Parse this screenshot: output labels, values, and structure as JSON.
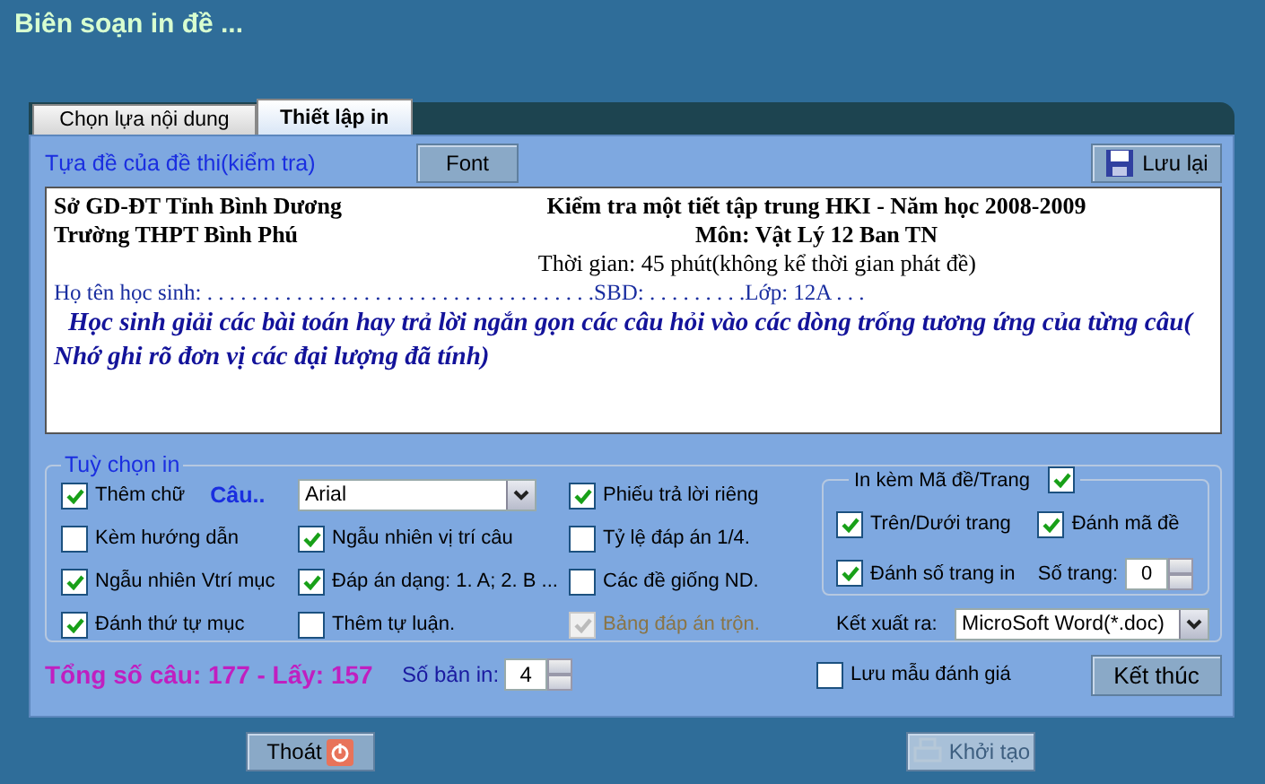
{
  "window": {
    "title": "Biên soạn in đề ..."
  },
  "tabs": [
    {
      "label": "Chọn lựa nội dung",
      "selected": false
    },
    {
      "label": "Thiết lập in",
      "selected": true
    }
  ],
  "header": {
    "title_label": "Tựa đề của đề thi(kiểm tra)",
    "font_button": "Font",
    "save_button": "Lưu lại"
  },
  "document": {
    "rows": [
      {
        "kind": "pair",
        "left": "Sở GD-ĐT Tỉnh Bình Dương",
        "right": "Kiểm tra một tiết tập trung HKI - Năm học 2008-2009"
      },
      {
        "kind": "pair",
        "left": "Trường THPT Bình Phú",
        "right": "Môn: Vật Lý 12 Ban TN"
      },
      {
        "kind": "center",
        "text": "Thời gian: 45 phút(không kể thời gian phát đề)"
      },
      {
        "kind": "fill",
        "text": "Họ tên học sinh: . . . . . . . . . . . . . . . . . . . . . . . . . . . . . . . . . . .SBD: . . . . . . . . .Lớp: 12A . . ."
      },
      {
        "kind": "note",
        "text": "Học sinh giải các bài toán hay trả lời ngắn gọn các câu hỏi vào các dòng trống tương ứng của từng câu( Nhớ ghi rõ đơn vị các đại lượng đã tính)"
      }
    ]
  },
  "options": {
    "title": "Tuỳ chọn in",
    "columns": [
      [
        {
          "kind": "checkbox",
          "label": "Thêm chữ",
          "checked": true,
          "disabled": false,
          "extra": "Câu.."
        },
        {
          "kind": "checkbox",
          "label": "Kèm hướng dẫn",
          "checked": false,
          "disabled": false
        },
        {
          "kind": "checkbox",
          "label": "Ngẫu nhiên Vtrí mục",
          "checked": true,
          "disabled": false
        },
        {
          "kind": "checkbox",
          "label": "Đánh thứ tự mục",
          "checked": true,
          "disabled": false
        }
      ],
      [
        {
          "kind": "dropdown",
          "value": "Arial"
        },
        {
          "kind": "checkbox",
          "label": "Ngẫu nhiên vị trí câu",
          "checked": true,
          "disabled": false
        },
        {
          "kind": "checkbox",
          "label": "Đáp án dạng: 1. A; 2. B ...",
          "checked": true,
          "disabled": false
        },
        {
          "kind": "checkbox",
          "label": "Thêm tự luận.",
          "checked": false,
          "disabled": false
        }
      ],
      [
        {
          "kind": "checkbox",
          "label": "Phiếu trả lời riêng",
          "checked": true,
          "disabled": false
        },
        {
          "kind": "checkbox",
          "label": "Tỷ lệ đáp án 1/4.",
          "checked": false,
          "disabled": false
        },
        {
          "kind": "checkbox",
          "label": "Các đề giống ND.",
          "checked": false,
          "disabled": false
        },
        {
          "kind": "checkbox",
          "label": "Bảng đáp án trộn.",
          "checked": true,
          "disabled": true
        }
      ]
    ],
    "code_group": {
      "title": "In kèm Mã đề/Trang",
      "checked": true,
      "items": [
        {
          "label": "Trên/Dưới trang",
          "checked": true
        },
        {
          "label": "Đánh mã đề",
          "checked": true
        },
        {
          "label": "Đánh số trang in",
          "checked": true
        }
      ],
      "pages_label": "Số trang:",
      "pages_value": "0"
    },
    "export": {
      "label": "Kết xuất ra:",
      "value": "MicroSoft Word(*.doc)"
    }
  },
  "bottom": {
    "summary": "Tổng số câu: 177 - Lấy: 157",
    "copies_label": "Số bản in:",
    "copies_value": "4",
    "save_template": {
      "label": "Lưu mẫu đánh giá",
      "checked": false
    },
    "finish_button": "Kết thúc"
  },
  "footer": [
    {
      "label": "Thoát",
      "kind": "exit",
      "disabled": false
    },
    {
      "label": "Khởi tạo",
      "kind": "create",
      "disabled": true
    }
  ]
}
